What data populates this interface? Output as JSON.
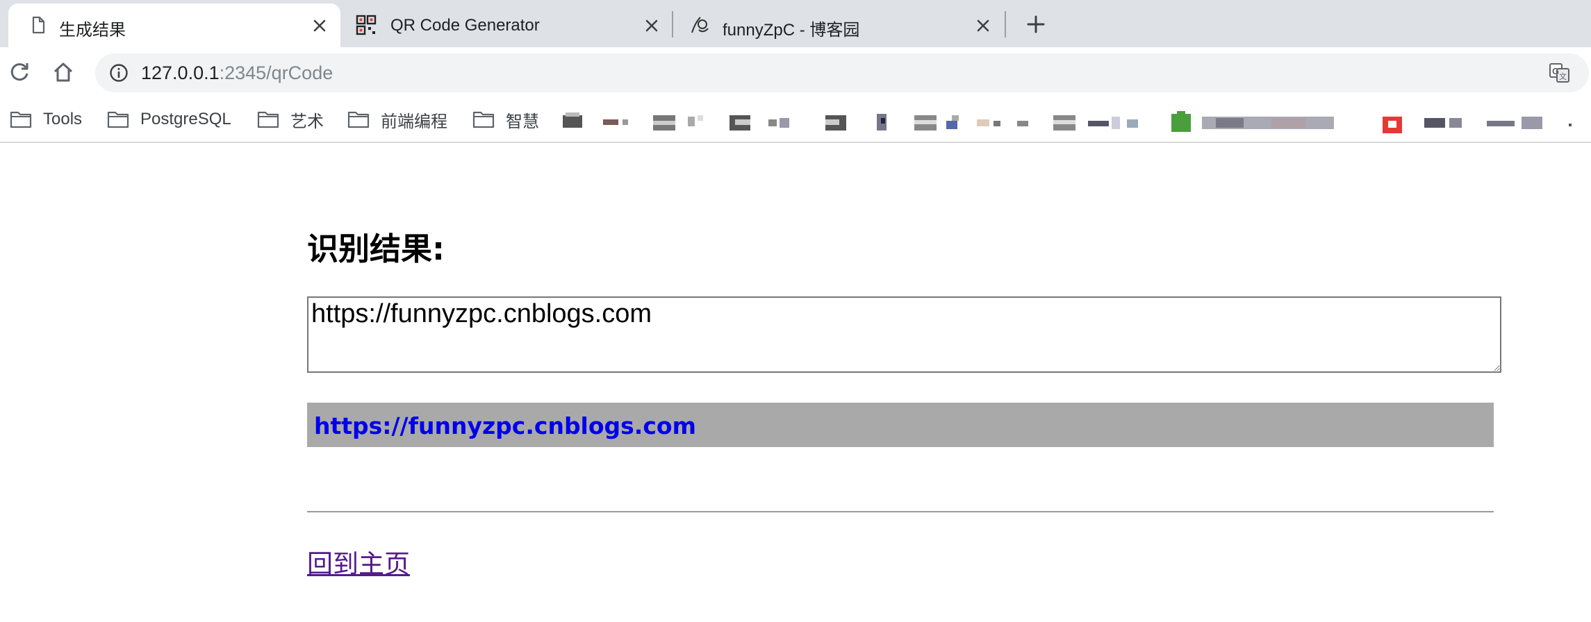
{
  "tabs": [
    {
      "title": "生成结果",
      "active": true,
      "icon": "document-icon"
    },
    {
      "title": "QR Code Generator",
      "active": false,
      "icon": "qr-code-icon"
    },
    {
      "title": "funnyZpC - 博客园",
      "active": false,
      "icon": "cnblogs-icon"
    }
  ],
  "toolbar": {
    "url_host": "127.0.0.1",
    "url_path": ":2345/qrCode"
  },
  "bookmarks": [
    {
      "label": "Tools",
      "icon": "folder-icon"
    },
    {
      "label": "PostgreSQL",
      "icon": "folder-icon"
    },
    {
      "label": "艺术",
      "icon": "folder-icon"
    },
    {
      "label": "前端编程",
      "icon": "folder-icon"
    },
    {
      "label": "智慧",
      "icon": "folder-icon"
    }
  ],
  "page": {
    "title": "识别结果:",
    "result_text": "https://funnyzpc.cnblogs.com",
    "result_link": "https://funnyzpc.cnblogs.com",
    "home_link": "回到主页"
  },
  "colors": {
    "tabstrip": "#dee1e6",
    "omnibox": "#f1f3f4",
    "link_bar": "#a9a9a9",
    "link": "#0000ee",
    "visited_link": "#551a8b"
  }
}
